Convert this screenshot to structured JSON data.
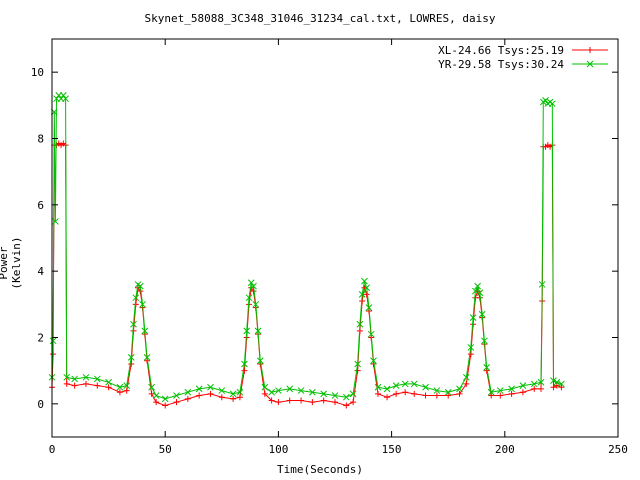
{
  "chart_data": {
    "type": "scatter",
    "title": "Skynet_58088_3C348_31046_31234_cal.txt, LOWRES, daisy",
    "xlabel": "Time(Seconds)",
    "ylabel": "Power (Kelvin)",
    "xlim": [
      0,
      250
    ],
    "ylim": [
      -1,
      11
    ],
    "xticks": [
      0,
      50,
      100,
      150,
      200,
      250
    ],
    "yticks": [
      0,
      2,
      4,
      6,
      8,
      10
    ],
    "grid": false,
    "legend_position": "top-right",
    "series": [
      {
        "name": "XL-24.66 Tsys:25.19",
        "color": "#ff0000",
        "marker": "plus",
        "points": [
          [
            0,
            0.5
          ],
          [
            0.5,
            1.5
          ],
          [
            1,
            7.8
          ],
          [
            2,
            7.8
          ],
          [
            3,
            7.85
          ],
          [
            4,
            7.8
          ],
          [
            5,
            7.85
          ],
          [
            6,
            7.8
          ],
          [
            6.5,
            0.6
          ],
          [
            10,
            0.55
          ],
          [
            15,
            0.6
          ],
          [
            20,
            0.55
          ],
          [
            25,
            0.5
          ],
          [
            30,
            0.35
          ],
          [
            33,
            0.4
          ],
          [
            35,
            1.2
          ],
          [
            36,
            2.2
          ],
          [
            37,
            3.0
          ],
          [
            38,
            3.5
          ],
          [
            39,
            3.4
          ],
          [
            40,
            2.9
          ],
          [
            41,
            2.1
          ],
          [
            42,
            1.3
          ],
          [
            44,
            0.3
          ],
          [
            46,
            0.05
          ],
          [
            50,
            -0.05
          ],
          [
            55,
            0.05
          ],
          [
            60,
            0.15
          ],
          [
            65,
            0.25
          ],
          [
            70,
            0.3
          ],
          [
            75,
            0.2
          ],
          [
            80,
            0.15
          ],
          [
            83,
            0.2
          ],
          [
            85,
            1.0
          ],
          [
            86,
            2.0
          ],
          [
            87,
            3.0
          ],
          [
            88,
            3.5
          ],
          [
            89,
            3.4
          ],
          [
            90,
            2.9
          ],
          [
            91,
            2.1
          ],
          [
            92,
            1.2
          ],
          [
            94,
            0.3
          ],
          [
            97,
            0.1
          ],
          [
            100,
            0.05
          ],
          [
            105,
            0.1
          ],
          [
            110,
            0.1
          ],
          [
            115,
            0.05
          ],
          [
            120,
            0.1
          ],
          [
            125,
            0.05
          ],
          [
            130,
            -0.05
          ],
          [
            133,
            0.05
          ],
          [
            135,
            1.0
          ],
          [
            136,
            2.2
          ],
          [
            137,
            3.1
          ],
          [
            138,
            3.5
          ],
          [
            139,
            3.3
          ],
          [
            140,
            2.8
          ],
          [
            141,
            2.0
          ],
          [
            142,
            1.2
          ],
          [
            144,
            0.3
          ],
          [
            148,
            0.2
          ],
          [
            152,
            0.3
          ],
          [
            156,
            0.35
          ],
          [
            160,
            0.3
          ],
          [
            165,
            0.25
          ],
          [
            170,
            0.25
          ],
          [
            175,
            0.25
          ],
          [
            180,
            0.3
          ],
          [
            183,
            0.6
          ],
          [
            185,
            1.5
          ],
          [
            186,
            2.4
          ],
          [
            187,
            3.2
          ],
          [
            188,
            3.4
          ],
          [
            189,
            3.2
          ],
          [
            190,
            2.6
          ],
          [
            191,
            1.8
          ],
          [
            192,
            1.0
          ],
          [
            194,
            0.25
          ],
          [
            198,
            0.25
          ],
          [
            203,
            0.3
          ],
          [
            208,
            0.35
          ],
          [
            213,
            0.45
          ],
          [
            216,
            0.45
          ],
          [
            216.5,
            3.1
          ],
          [
            217,
            7.75
          ],
          [
            218,
            7.75
          ],
          [
            219,
            7.8
          ],
          [
            220,
            7.75
          ],
          [
            221,
            7.8
          ],
          [
            221.5,
            0.5
          ],
          [
            223,
            0.55
          ],
          [
            225,
            0.5
          ]
        ]
      },
      {
        "name": "YR-29.58 Tsys:30.24",
        "color": "#00c000",
        "marker": "cross",
        "points": [
          [
            0,
            0.8
          ],
          [
            0.5,
            1.9
          ],
          [
            1,
            8.8
          ],
          [
            1.5,
            5.5
          ],
          [
            2,
            9.2
          ],
          [
            3,
            9.3
          ],
          [
            4,
            9.2
          ],
          [
            5,
            9.3
          ],
          [
            6,
            9.2
          ],
          [
            6.5,
            0.8
          ],
          [
            10,
            0.75
          ],
          [
            15,
            0.8
          ],
          [
            20,
            0.75
          ],
          [
            25,
            0.65
          ],
          [
            30,
            0.5
          ],
          [
            33,
            0.55
          ],
          [
            35,
            1.4
          ],
          [
            36,
            2.4
          ],
          [
            37,
            3.2
          ],
          [
            38,
            3.6
          ],
          [
            39,
            3.55
          ],
          [
            40,
            3.0
          ],
          [
            41,
            2.2
          ],
          [
            42,
            1.4
          ],
          [
            44,
            0.5
          ],
          [
            46,
            0.25
          ],
          [
            50,
            0.15
          ],
          [
            55,
            0.25
          ],
          [
            60,
            0.35
          ],
          [
            65,
            0.45
          ],
          [
            70,
            0.5
          ],
          [
            75,
            0.4
          ],
          [
            80,
            0.3
          ],
          [
            83,
            0.35
          ],
          [
            85,
            1.2
          ],
          [
            86,
            2.2
          ],
          [
            87,
            3.2
          ],
          [
            88,
            3.65
          ],
          [
            89,
            3.55
          ],
          [
            90,
            3.0
          ],
          [
            91,
            2.2
          ],
          [
            92,
            1.3
          ],
          [
            94,
            0.5
          ],
          [
            97,
            0.35
          ],
          [
            100,
            0.4
          ],
          [
            105,
            0.45
          ],
          [
            110,
            0.4
          ],
          [
            115,
            0.35
          ],
          [
            120,
            0.3
          ],
          [
            125,
            0.25
          ],
          [
            130,
            0.2
          ],
          [
            133,
            0.3
          ],
          [
            135,
            1.2
          ],
          [
            136,
            2.4
          ],
          [
            137,
            3.3
          ],
          [
            138,
            3.7
          ],
          [
            139,
            3.5
          ],
          [
            140,
            2.9
          ],
          [
            141,
            2.1
          ],
          [
            142,
            1.3
          ],
          [
            144,
            0.5
          ],
          [
            148,
            0.45
          ],
          [
            152,
            0.55
          ],
          [
            156,
            0.6
          ],
          [
            160,
            0.6
          ],
          [
            165,
            0.5
          ],
          [
            170,
            0.4
          ],
          [
            175,
            0.35
          ],
          [
            180,
            0.45
          ],
          [
            183,
            0.8
          ],
          [
            185,
            1.7
          ],
          [
            186,
            2.6
          ],
          [
            187,
            3.4
          ],
          [
            188,
            3.55
          ],
          [
            189,
            3.35
          ],
          [
            190,
            2.7
          ],
          [
            191,
            1.9
          ],
          [
            192,
            1.1
          ],
          [
            194,
            0.35
          ],
          [
            198,
            0.4
          ],
          [
            203,
            0.45
          ],
          [
            208,
            0.55
          ],
          [
            213,
            0.6
          ],
          [
            216,
            0.65
          ],
          [
            216.5,
            3.6
          ],
          [
            217,
            9.1
          ],
          [
            218,
            9.15
          ],
          [
            219,
            9.05
          ],
          [
            220,
            9.1
          ],
          [
            221,
            9.05
          ],
          [
            221.5,
            0.7
          ],
          [
            223,
            0.65
          ],
          [
            225,
            0.6
          ]
        ]
      }
    ]
  }
}
